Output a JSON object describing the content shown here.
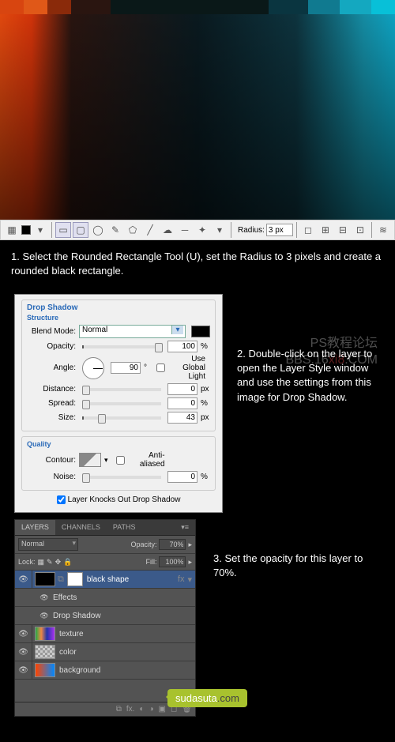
{
  "toolbar": {
    "radius_label": "Radius:",
    "radius_value": "3 px"
  },
  "step1": "1. Select the Rounded Rectangle Tool (U), set the Radius to 3 pixels and create a rounded black rectangle.",
  "ds": {
    "title": "Drop Shadow",
    "structure": "Structure",
    "blend_mode_label": "Blend Mode:",
    "blend_mode": "Normal",
    "opacity_label": "Opacity:",
    "opacity": "100",
    "pct": "%",
    "angle_label": "Angle:",
    "angle": "90",
    "deg": "°",
    "global": "Use Global Light",
    "distance_label": "Distance:",
    "distance": "0",
    "px": "px",
    "spread_label": "Spread:",
    "spread": "0",
    "size_label": "Size:",
    "size": "43",
    "quality": "Quality",
    "contour_label": "Contour:",
    "aa": "Anti-aliased",
    "noise_label": "Noise:",
    "noise": "0",
    "knock": "Layer Knocks Out Drop Shadow"
  },
  "step2": "2. Double-click on the layer to open the Layer Style window and use the settings from this image for Drop Shadow.",
  "watermark": {
    "l1": "PS教程论坛",
    "l2": "BBS.16",
    "l3": ".COM",
    "red": "xi8"
  },
  "layers": {
    "tab_layers": "LAYERS",
    "tab_channels": "CHANNELS",
    "tab_paths": "PATHS",
    "blend": "Normal",
    "opacity_label": "Opacity:",
    "opacity": "70%",
    "lock_label": "Lock:",
    "fill_label": "Fill:",
    "fill": "100%",
    "items": [
      {
        "name": "black shape",
        "fx": "fx"
      },
      {
        "name": "Effects"
      },
      {
        "name": "Drop Shadow"
      },
      {
        "name": "texture"
      },
      {
        "name": "color"
      },
      {
        "name": "background"
      }
    ]
  },
  "step3": "3. Set the opacity for this layer to 70%.",
  "logo": {
    "a": "sudasuta",
    "b": ".com"
  }
}
